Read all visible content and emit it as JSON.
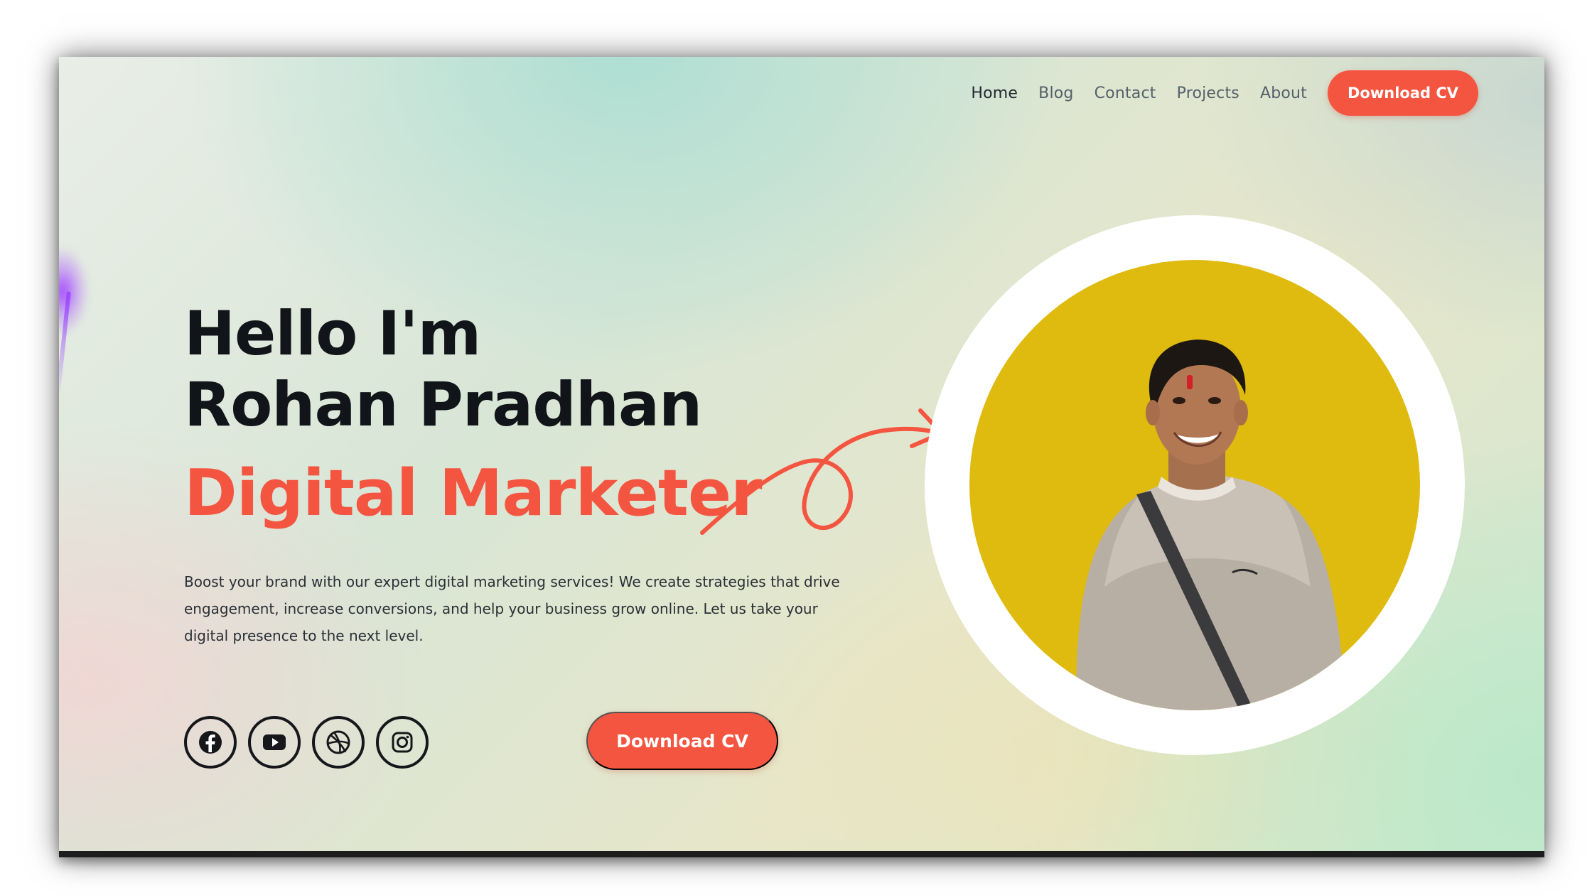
{
  "nav": {
    "links": [
      "Home",
      "Blog",
      "Contact",
      "Projects",
      "About"
    ],
    "cta_label": "Download CV"
  },
  "hero": {
    "greeting_line1": "Hello I'm",
    "greeting_line2": "Rohan Pradhan",
    "role": "Digital Marketer",
    "description": "Boost your brand with our expert digital marketing services! We create strategies that drive engagement, increase conversions, and help your business grow online. Let us take your digital presence to the next level.",
    "cta_label": "Download CV"
  },
  "socials": [
    {
      "name": "facebook-icon"
    },
    {
      "name": "youtube-icon"
    },
    {
      "name": "dribbble-icon"
    },
    {
      "name": "instagram-icon"
    }
  ],
  "colors": {
    "accent": "#f45540",
    "heading": "#111418",
    "portrait_bg": "#dfba0f"
  }
}
